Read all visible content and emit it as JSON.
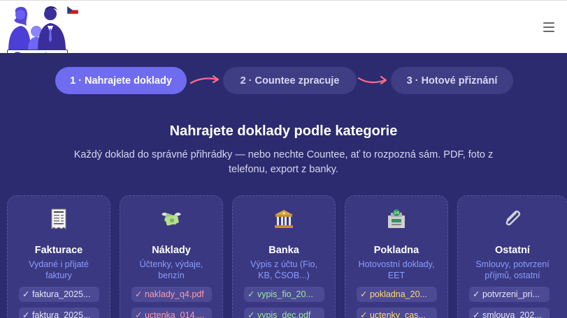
{
  "header": {
    "logo_text": "Countee",
    "flag_icon": "czech-flag-icon",
    "menu_icon": "hamburger-menu-icon"
  },
  "steps": [
    {
      "label": "1 · Nahrajete doklady",
      "active": true
    },
    {
      "label": "2 · Countee zpracuje",
      "active": false
    },
    {
      "label": "3 · Hotové přiznání",
      "active": false
    }
  ],
  "main": {
    "heading": "Nahrajete doklady podle kategorie",
    "subtitle_line1": "Každý doklad do správné přihrádky — nebo nechte Countee, ať to rozpozná sám. PDF, foto z",
    "subtitle_line2": "telefonu, export z banky."
  },
  "categories": [
    {
      "title": "Fakturace",
      "desc_line1": "Vydané i přijaté",
      "desc_line2": "faktury",
      "icon": "receipt-icon",
      "files": [
        "✓ faktura_2025...",
        "✓ faktura_2025..."
      ],
      "file_color": "white"
    },
    {
      "title": "Náklady",
      "desc_line1": "Účtenky, výdaje,",
      "desc_line2": "benzín",
      "icon": "money-wings-icon",
      "files": [
        "✓ naklady_q4.pdf",
        "✓ uctenka_014...."
      ],
      "file_color": "red"
    },
    {
      "title": "Banka",
      "desc_line1": "Výpis z účtu (Fio,",
      "desc_line2": "KB, ČSOB...)",
      "icon": "bank-icon",
      "files": [
        "✓ vypis_fio_20...",
        "✓ vypis_dec.pdf"
      ],
      "file_color": "green"
    },
    {
      "title": "Pokladna",
      "desc_line1": "Hotovostní doklady,",
      "desc_line2": "EET",
      "icon": "atm-icon",
      "files": [
        "✓ pokladna_20...",
        "✓ uctenky_cas..."
      ],
      "file_color": "yellow"
    },
    {
      "title": "Ostatní",
      "desc_line1": "Smlouvy, potvrzení",
      "desc_line2": "příjmů, ostatní",
      "icon": "paperclip-icon",
      "files": [
        "✓ potvrzeni_pri...",
        "✓ smlouva_202..."
      ],
      "file_color": "white"
    }
  ],
  "colors": {
    "background": "#2c2b70",
    "step_active": "#6f6cf0",
    "arrow": "#ff6b8a",
    "desc": "#8a9dff"
  }
}
